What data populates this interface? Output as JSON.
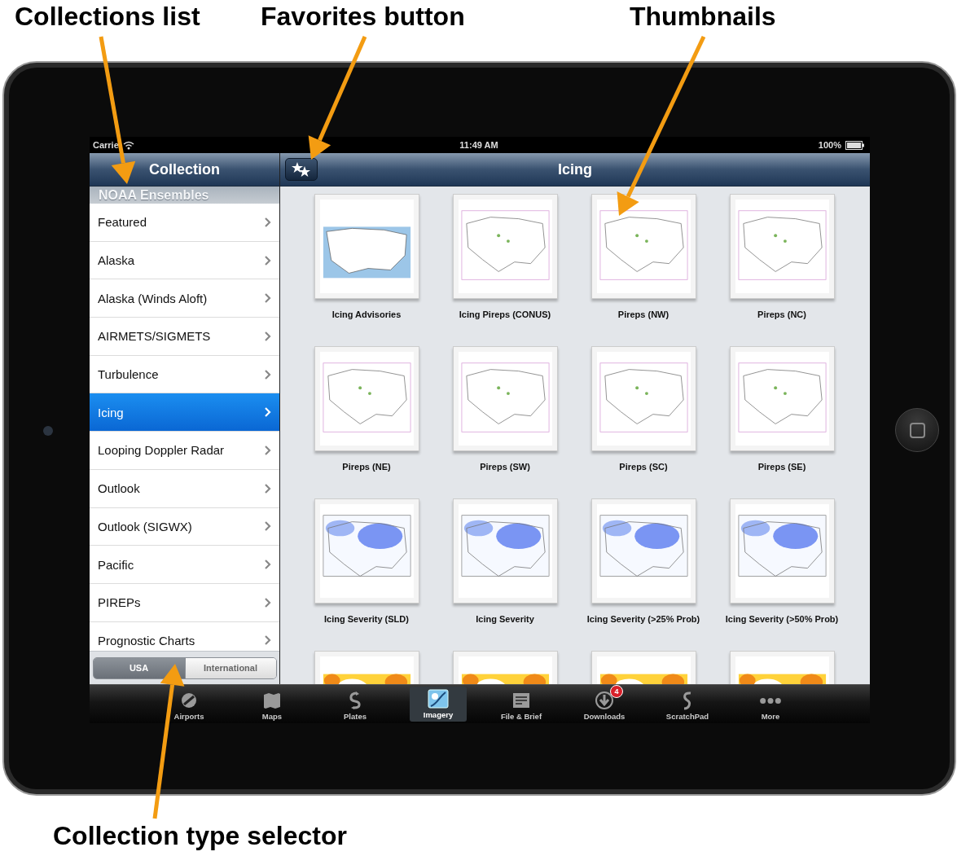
{
  "annotations": [
    {
      "label": "Collections list"
    },
    {
      "label": "Favorites button"
    },
    {
      "label": "Thumbnails"
    },
    {
      "label": "Collection type selector"
    }
  ],
  "status_bar": {
    "carrier": "Carrie",
    "time": "11:49 AM",
    "battery": "100%"
  },
  "sidebar": {
    "title": "Collection",
    "section": "NOAA Ensembles",
    "items": [
      {
        "label": "Featured",
        "selected": false
      },
      {
        "label": "Alaska",
        "selected": false
      },
      {
        "label": "Alaska (Winds Aloft)",
        "selected": false
      },
      {
        "label": "AIRMETS/SIGMETS",
        "selected": false
      },
      {
        "label": "Turbulence",
        "selected": false
      },
      {
        "label": "Icing",
        "selected": true
      },
      {
        "label": "Looping Doppler Radar",
        "selected": false
      },
      {
        "label": "Outlook",
        "selected": false
      },
      {
        "label": "Outlook (SIGWX)",
        "selected": false
      },
      {
        "label": "Pacific",
        "selected": false
      },
      {
        "label": "PIREPs",
        "selected": false
      },
      {
        "label": "Prognostic Charts",
        "selected": false
      }
    ],
    "segments": [
      {
        "label": "USA",
        "selected": true
      },
      {
        "label": "International",
        "selected": false
      }
    ]
  },
  "content": {
    "title": "Icing",
    "thumbnails": [
      {
        "label": "Icing Advisories",
        "kind": "advisory"
      },
      {
        "label": "Icing Pireps (CONUS)",
        "kind": "pireps"
      },
      {
        "label": "Pireps (NW)",
        "kind": "pireps"
      },
      {
        "label": "Pireps (NC)",
        "kind": "pireps"
      },
      {
        "label": "Pireps (NE)",
        "kind": "pireps"
      },
      {
        "label": "Pireps (SW)",
        "kind": "pireps"
      },
      {
        "label": "Pireps (SC)",
        "kind": "pireps"
      },
      {
        "label": "Pireps (SE)",
        "kind": "pireps"
      },
      {
        "label": "Icing Severity (SLD)",
        "kind": "severity"
      },
      {
        "label": "Icing Severity",
        "kind": "severity"
      },
      {
        "label": "Icing Severity (>25% Prob)",
        "kind": "severity"
      },
      {
        "label": "Icing Severity (>50% Prob)",
        "kind": "severity"
      },
      {
        "kind": "probability"
      },
      {
        "kind": "probability"
      },
      {
        "kind": "probability"
      },
      {
        "kind": "probability"
      }
    ]
  },
  "tab_bar": [
    {
      "label": "Airports",
      "kind": "airports",
      "selected": false
    },
    {
      "label": "Maps",
      "kind": "maps",
      "selected": false
    },
    {
      "label": "Plates",
      "kind": "plates",
      "selected": false
    },
    {
      "label": "Imagery",
      "kind": "imagery",
      "selected": true
    },
    {
      "label": "File & Brief",
      "kind": "file",
      "selected": false
    },
    {
      "label": "Downloads",
      "kind": "downloads",
      "selected": false,
      "badge": "4"
    },
    {
      "label": "ScratchPad",
      "kind": "scratchpad",
      "selected": false
    },
    {
      "label": "More",
      "kind": "more",
      "selected": false
    }
  ]
}
